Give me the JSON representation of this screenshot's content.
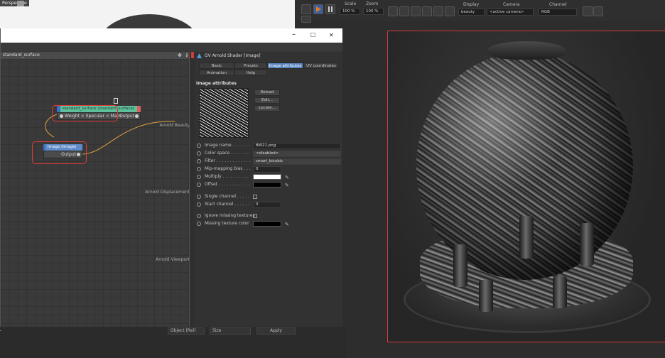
{
  "viewport": {
    "label": "Perspective"
  },
  "render_toolbar": {
    "scale_label": "Scale",
    "zoom_label": "Zoom",
    "scale_value": "100 %",
    "zoom_value": "100 %",
    "display_label": "Display",
    "camera_label": "Camera",
    "channel_label": "Channel",
    "display_value": "beauty",
    "camera_value": "<active camera>",
    "channel_value": "RGB"
  },
  "node_window": {
    "minimize": "–",
    "maximize": "☐",
    "close": "✕",
    "graph_title": "standard_surface",
    "nodes": {
      "standard": {
        "title": "standard_surface (standard_surface)",
        "input": "Weight < Specular < Main",
        "output": "Output"
      },
      "image": {
        "title": "Image (Image)",
        "output": "Output"
      }
    },
    "outputs": {
      "beauty": "Arnold Beauty",
      "displacement": "Arnold Displacement",
      "viewport": "Arnold Viewport"
    }
  },
  "attributes": {
    "title": "GV Arnold Shader [Image]",
    "tabs": [
      {
        "label": "Basic",
        "active": false
      },
      {
        "label": "Presets",
        "active": false
      },
      {
        "label": "Image attributes",
        "active": true
      },
      {
        "label": "UV coordinates",
        "active": false
      },
      {
        "label": "Animation",
        "active": false
      },
      {
        "label": "Help",
        "active": false
      }
    ],
    "section": "Image attributes",
    "buttons": {
      "reload": "Reload",
      "edit": "Edit...",
      "locate": "Locate..."
    },
    "rows": {
      "image_name": {
        "label": "Image name . . . . . . .",
        "value": "BW21.png"
      },
      "color_space": {
        "label": "Color space . . . . . . .",
        "value": "<disabled>"
      },
      "filter": {
        "label": "Filter . . . . . . . . . . . . .",
        "value": "smart_bicubic"
      },
      "mip_bias": {
        "label": "Mip-mapping bias . . .",
        "value": "0"
      },
      "multiply": {
        "label": "Multiply . . . . . . . . . ."
      },
      "offset": {
        "label": "Offset . . . . . . . . . . . ."
      },
      "single_channel": {
        "label": "Single channel . . . . ."
      },
      "start_channel": {
        "label": "Start channel . . . . . .",
        "value": "0"
      },
      "ignore_missing": {
        "label": "Ignore missing textures"
      },
      "missing_color": {
        "label": "Missing texture color"
      }
    },
    "colors": {
      "multiply": "#ffffff",
      "offset": "#000000",
      "missing": "#000000"
    }
  },
  "bottom": {
    "field1": "Object (Rel)",
    "field2": "Size",
    "apply": "Apply"
  }
}
